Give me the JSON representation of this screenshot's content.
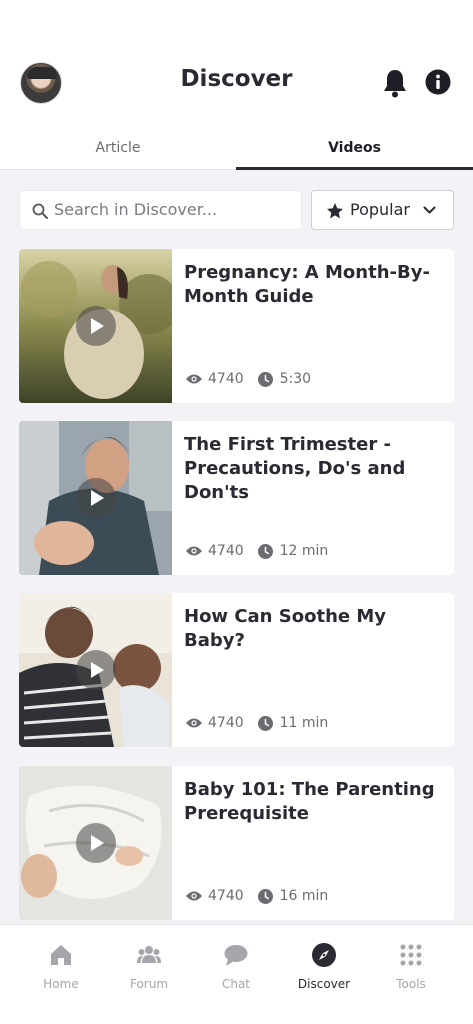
{
  "header": {
    "title": "Discover"
  },
  "tabs": [
    {
      "label": "Article",
      "active": false
    },
    {
      "label": "Videos",
      "active": true
    }
  ],
  "search": {
    "placeholder": "Search in Discover..."
  },
  "sort": {
    "label": "Popular",
    "icon": "star-icon"
  },
  "videos": [
    {
      "title": "Pregnancy: A Month-By-Month Guide",
      "views": "4740",
      "duration": "5:30"
    },
    {
      "title": "The First Trimester - Precautions, Do's and Don'ts",
      "views": "4740",
      "duration": "12 min"
    },
    {
      "title": "How Can Soothe My Baby?",
      "views": "4740",
      "duration": "11 min"
    },
    {
      "title": "Baby 101: The Parenting Prerequisite",
      "views": "4740",
      "duration": "16 min"
    }
  ],
  "nav": [
    {
      "label": "Home",
      "icon": "home-icon",
      "active": false
    },
    {
      "label": "Forum",
      "icon": "group-icon",
      "active": false
    },
    {
      "label": "Chat",
      "icon": "chat-bubble-icon",
      "active": false
    },
    {
      "label": "Discover",
      "icon": "compass-icon",
      "active": true
    },
    {
      "label": "Tools",
      "icon": "grid-dots-icon",
      "active": false
    }
  ],
  "colors": {
    "text": "#2b2a33",
    "muted": "#a5a5ac",
    "background": "#f3f2f7"
  }
}
